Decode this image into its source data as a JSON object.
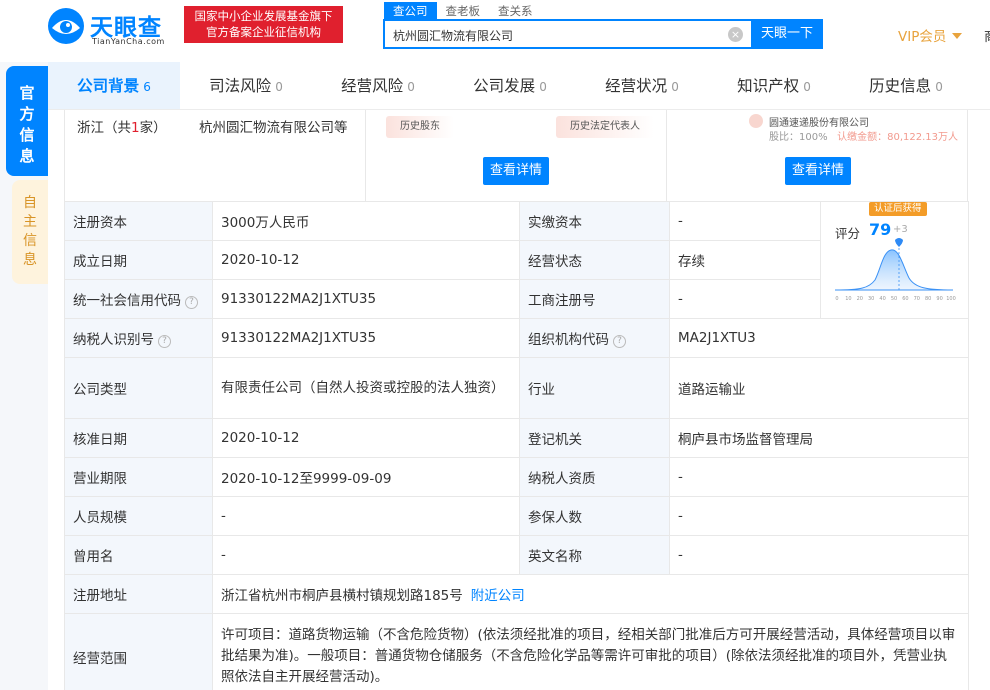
{
  "header": {
    "logo_text": "天眼查",
    "logo_sub": "TianYanCha.com",
    "badge_line1": "国家中小企业发展基金旗下",
    "badge_line2": "官方备案企业征信机构",
    "search_tabs": [
      "查公司",
      "查老板",
      "查关系"
    ],
    "search_value": "杭州圆汇物流有限公司",
    "clear_glyph": "×",
    "search_button": "天眼一下",
    "vip": "VIP会员",
    "cut_text": "商"
  },
  "side_tabs": {
    "official": "官方信息",
    "self": "自主信息"
  },
  "nav": [
    {
      "label": "公司背景",
      "count": "6"
    },
    {
      "label": "司法风险",
      "count": "0"
    },
    {
      "label": "经营风险",
      "count": "0"
    },
    {
      "label": "公司发展",
      "count": "0"
    },
    {
      "label": "经营状况",
      "count": "0"
    },
    {
      "label": "知识产权",
      "count": "0"
    },
    {
      "label": "历史信息",
      "count": "0"
    }
  ],
  "top_panel": {
    "region_prefix": "浙江（共",
    "region_count": "1",
    "region_suffix": "家）",
    "region_company": "杭州圆汇物流有限公司等",
    "tag_history_shareholder": "历史股东",
    "tag_history_legal": "历史法定代表人",
    "faded_company": "圆通速递股份有限公司",
    "faded_ratio": "股比：100%",
    "faded_amount": "认缴金额：80,122.13万人",
    "detail_btn": "查看详情"
  },
  "info": {
    "reg_capital_label": "注册资本",
    "reg_capital": "3000万人民币",
    "paid_capital_label": "实缴资本",
    "paid_capital": "-",
    "founded_label": "成立日期",
    "founded": "2020-10-12",
    "status_label": "经营状态",
    "status": "存续",
    "credit_code_label": "统一社会信用代码",
    "credit_code": "91330122MA2J1XTU35",
    "biz_reg_no_label": "工商注册号",
    "biz_reg_no": "-",
    "taxpayer_id_label": "纳税人识别号",
    "taxpayer_id": "91330122MA2J1XTU35",
    "org_code_label": "组织机构代码",
    "org_code": "MA2J1XTU3",
    "company_type_label": "公司类型",
    "company_type": "有限责任公司（自然人投资或控股的法人独资）",
    "industry_label": "行业",
    "industry": "道路运输业",
    "approval_date_label": "核准日期",
    "approval_date": "2020-10-12",
    "reg_authority_label": "登记机关",
    "reg_authority": "桐庐县市场监督管理局",
    "term_label": "营业期限",
    "term": "2020-10-12至9999-09-09",
    "taxpayer_quality_label": "纳税人资质",
    "taxpayer_quality": "-",
    "staff_size_label": "人员规模",
    "staff_size": "-",
    "insured_label": "参保人数",
    "insured": "-",
    "former_name_label": "曾用名",
    "former_name": "-",
    "english_name_label": "英文名称",
    "english_name": "-",
    "address_label": "注册地址",
    "address": "浙江省杭州市桐庐县横村镇规划路185号",
    "nearby_link": "附近公司",
    "scope_label": "经营范围",
    "scope": "许可项目：道路货物运输（不含危险货物）(依法须经批准的项目，经相关部门批准后方可开展经营活动，具体经营项目以审批结果为准)。一般项目：普通货物仓储服务（不含危险化学品等需许可审批的项目）(除依法须经批准的项目外，凭营业执照依法自主开展经营活动)。",
    "help_glyph": "?"
  },
  "score": {
    "badge": "认证后获得",
    "label": "评分",
    "value": "79",
    "delta": "+3",
    "axis_ticks": [
      "0",
      "10",
      "20",
      "30",
      "40",
      "50",
      "60",
      "70",
      "80",
      "90",
      "100"
    ]
  }
}
